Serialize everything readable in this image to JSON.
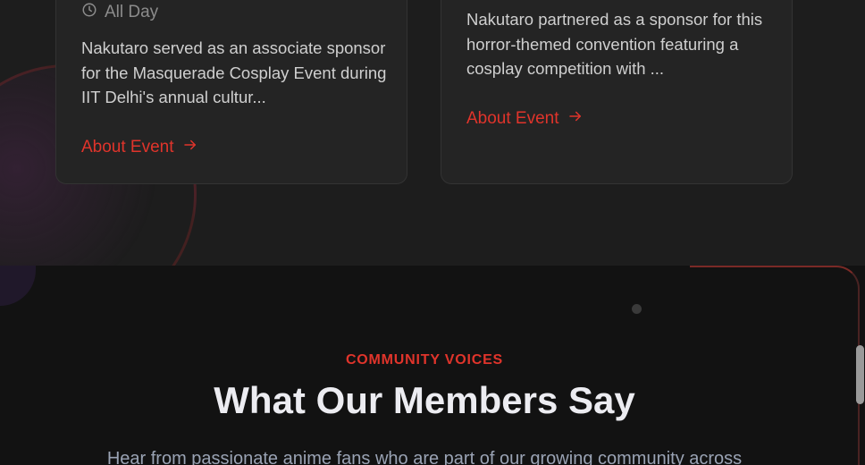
{
  "events": [
    {
      "time": "All Day",
      "description": "Nakutaro served as an associate sponsor for the Masquerade Cosplay Event during IIT Delhi's annual cultur...",
      "link_label": "About Event"
    },
    {
      "description": "Nakutaro partnered as a sponsor for this horror-themed convention featuring a cosplay competition with ...",
      "link_label": "About Event"
    }
  ],
  "community": {
    "eyebrow": "COMMUNITY VOICES",
    "title": "What Our Members Say",
    "subtitle": "Hear from passionate anime fans who are part of our growing community across"
  },
  "icons": [
    "clock-icon",
    "arrow-right-icon"
  ],
  "colors": {
    "accent": "#e0342b",
    "background": "#121212",
    "card": "#242424"
  }
}
